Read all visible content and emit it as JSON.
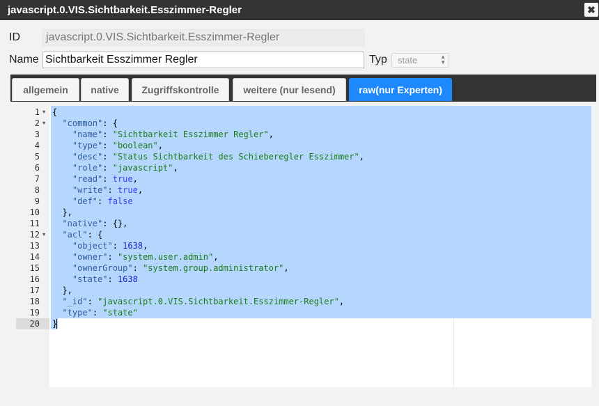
{
  "dialog": {
    "title": "javascript.0.VIS.Sichtbarkeit.Esszimmer-Regler",
    "close_glyph": "✖"
  },
  "form": {
    "id_label": "ID",
    "id_value": "javascript.0.VIS.Sichtbarkeit.Esszimmer-Regler",
    "name_label": "Name",
    "name_value": "Sichtbarkeit Esszimmer Regler",
    "typ_label": "Typ",
    "typ_value": "state"
  },
  "tabs": [
    {
      "label": "allgemein",
      "active": false
    },
    {
      "label": "native",
      "active": false
    },
    {
      "label": "Zugriffskontrolle",
      "active": false
    },
    {
      "label": "weitere (nur lesend)",
      "active": false
    },
    {
      "label": "raw(nur Experten)",
      "active": true
    }
  ],
  "colors": {
    "titlebar": "#333333",
    "active_tab": "#1e88ff",
    "selection": "#b6d7fd"
  },
  "editor": {
    "lines": [
      {
        "n": "1",
        "fold": true,
        "code": "{"
      },
      {
        "n": "2",
        "fold": true,
        "code": "  \"common\": {"
      },
      {
        "n": "3",
        "fold": false,
        "code": "    \"name\": \"Sichtbarkeit Esszimmer Regler\","
      },
      {
        "n": "4",
        "fold": false,
        "code": "    \"type\": \"boolean\","
      },
      {
        "n": "5",
        "fold": false,
        "code": "    \"desc\": \"Status Sichtbarkeit des Schieberegler Esszimmer\","
      },
      {
        "n": "6",
        "fold": false,
        "code": "    \"role\": \"javascript\","
      },
      {
        "n": "7",
        "fold": false,
        "code": "    \"read\": true,"
      },
      {
        "n": "8",
        "fold": false,
        "code": "    \"write\": true,"
      },
      {
        "n": "9",
        "fold": false,
        "code": "    \"def\": false"
      },
      {
        "n": "10",
        "fold": false,
        "code": "  },"
      },
      {
        "n": "11",
        "fold": false,
        "code": "  \"native\": {},"
      },
      {
        "n": "12",
        "fold": true,
        "code": "  \"acl\": {"
      },
      {
        "n": "13",
        "fold": false,
        "code": "    \"object\": 1638,"
      },
      {
        "n": "14",
        "fold": false,
        "code": "    \"owner\": \"system.user.admin\","
      },
      {
        "n": "15",
        "fold": false,
        "code": "    \"ownerGroup\": \"system.group.administrator\","
      },
      {
        "n": "16",
        "fold": false,
        "code": "    \"state\": 1638"
      },
      {
        "n": "17",
        "fold": false,
        "code": "  },"
      },
      {
        "n": "18",
        "fold": false,
        "code": "  \"_id\": \"javascript.0.VIS.Sichtbarkeit.Esszimmer-Regler\","
      },
      {
        "n": "19",
        "fold": false,
        "code": "  \"type\": \"state\""
      },
      {
        "n": "20",
        "fold": false,
        "code": "}"
      }
    ]
  }
}
